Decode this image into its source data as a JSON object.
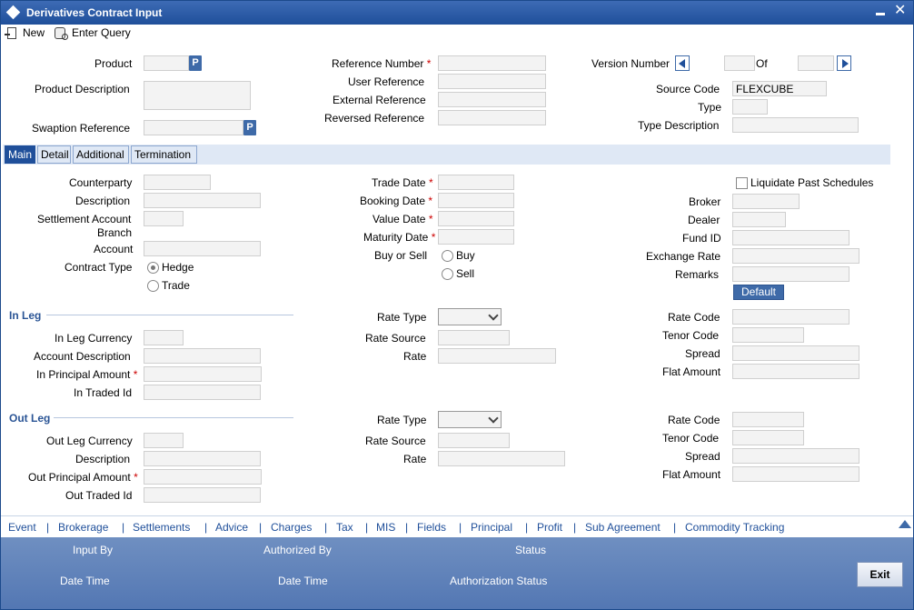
{
  "window": {
    "title": "Derivatives Contract Input"
  },
  "toolbar": {
    "new_label": "New",
    "enter_query_label": "Enter Query"
  },
  "header": {
    "product_label": "Product",
    "product_description_label": "Product Description",
    "swaption_reference_label": "Swaption Reference",
    "p_label": "P",
    "reference_number_label": "Reference Number",
    "user_reference_label": "User Reference",
    "external_reference_label": "External Reference",
    "reversed_reference_label": "Reversed Reference",
    "version_number_label": "Version Number",
    "of_label": "Of",
    "source_code_label": "Source Code",
    "source_code_value": "FLEXCUBE",
    "type_label": "Type",
    "type_description_label": "Type Description",
    "required_mark": "*"
  },
  "tabs": [
    "Main",
    "Detail",
    "Additional",
    "Termination"
  ],
  "main": {
    "counterparty_label": "Counterparty",
    "description_label": "Description",
    "settlement_account_branch_label_1": "Settlement Account",
    "settlement_account_branch_label_2": "Branch",
    "account_label": "Account",
    "contract_type_label": "Contract Type",
    "hedge_label": "Hedge",
    "trade_label": "Trade",
    "trade_date_label": "Trade Date",
    "booking_date_label": "Booking Date",
    "value_date_label": "Value Date",
    "maturity_date_label": "Maturity Date",
    "buy_or_sell_label": "Buy or Sell",
    "buy_label": "Buy",
    "sell_label": "Sell",
    "liquidate_label": "Liquidate Past Schedules",
    "broker_label": "Broker",
    "dealer_label": "Dealer",
    "fund_id_label": "Fund ID",
    "exchange_rate_label": "Exchange Rate",
    "remarks_label": "Remarks",
    "default_button": "Default"
  },
  "in_leg": {
    "title": "In Leg",
    "currency_label": "In Leg Currency",
    "account_description_label": "Account Description",
    "principal_amount_label": "In Principal Amount",
    "traded_id_label": "In Traded Id",
    "rate_type_label": "Rate Type",
    "rate_source_label": "Rate Source",
    "rate_label": "Rate",
    "rate_code_label": "Rate Code",
    "tenor_code_label": "Tenor Code",
    "spread_label": "Spread",
    "flat_amount_label": "Flat Amount"
  },
  "out_leg": {
    "title": "Out Leg",
    "currency_label": "Out Leg Currency",
    "description_label": "Description",
    "principal_amount_label": "Out Principal Amount",
    "traded_id_label": "Out Traded Id",
    "rate_type_label": "Rate Type",
    "rate_source_label": "Rate Source",
    "rate_label": "Rate",
    "rate_code_label": "Rate Code",
    "tenor_code_label": "Tenor Code",
    "spread_label": "Spread",
    "flat_amount_label": "Flat Amount"
  },
  "bottom_links": [
    "Event",
    "Brokerage",
    "Settlements",
    "Advice",
    "Charges",
    "Tax",
    "MIS",
    "Fields",
    "Principal",
    "Profit",
    "Sub Agreement",
    "Commodity Tracking"
  ],
  "link_separator": "|",
  "footer": {
    "input_by_label": "Input By",
    "authorized_by_label": "Authorized By",
    "status_label": "Status",
    "date_time_label_1": "Date Time",
    "date_time_label_2": "Date Time",
    "authorization_status_label": "Authorization Status",
    "exit_button": "Exit"
  },
  "colors": {
    "accent": "#1f4f9a",
    "footer": "#5f82bb",
    "required": "#cc0000"
  }
}
